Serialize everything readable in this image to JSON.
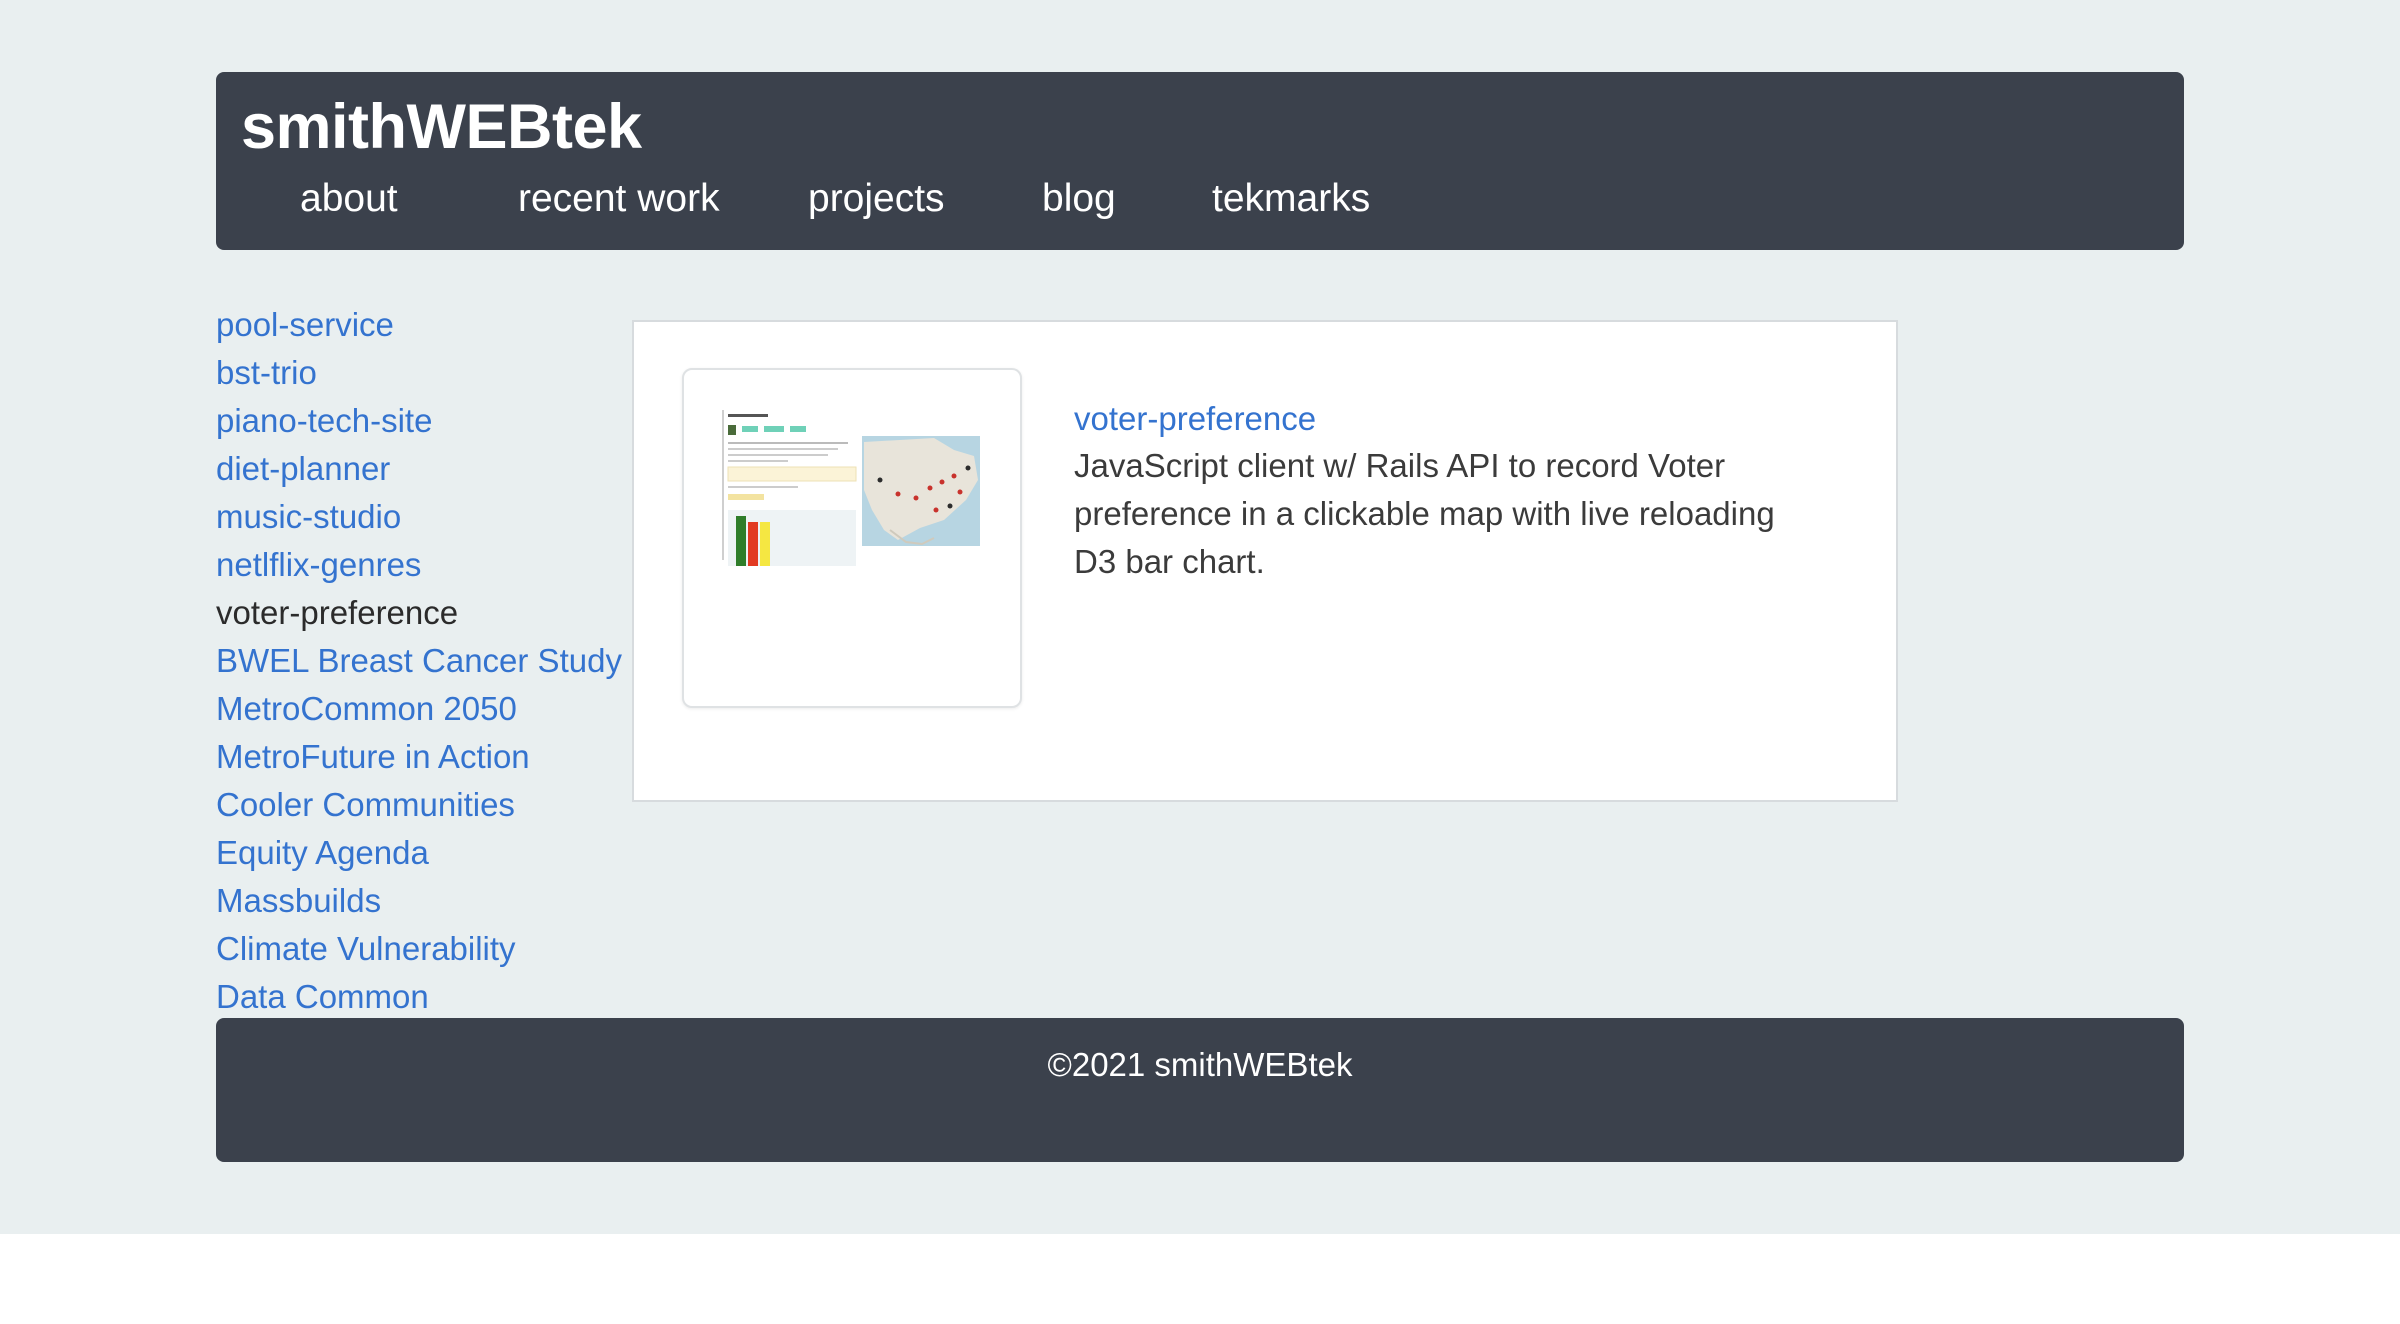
{
  "header": {
    "site_title": "smithWEBtek",
    "nav": [
      "about",
      "recent work",
      "projects",
      "blog",
      "tekmarks"
    ]
  },
  "sidebar": {
    "items": [
      "pool-service",
      "bst-trio",
      "piano-tech-site",
      "diet-planner",
      "music-studio",
      "netlflix-genres",
      "voter-preference",
      "BWEL Breast Cancer Study",
      "MetroCommon 2050",
      "MetroFuture in Action",
      "Cooler Communities",
      "Equity Agenda",
      "Massbuilds",
      "Climate Vulnerability",
      "Data Common"
    ],
    "active_item": "voter-preference"
  },
  "project": {
    "title": "voter-preference",
    "description": "JavaScript client w/ Rails API to record Voter preference in a clickable map with live reloading D3 bar chart.",
    "thumbnail": "voter-preference-screenshot"
  },
  "footer": {
    "copyright": "©2021 smithWEBtek"
  },
  "colors": {
    "page_background": "#e9eff0",
    "bar_background": "#3b414c",
    "link": "#3473cf",
    "active_link": "#2b2b2b"
  }
}
